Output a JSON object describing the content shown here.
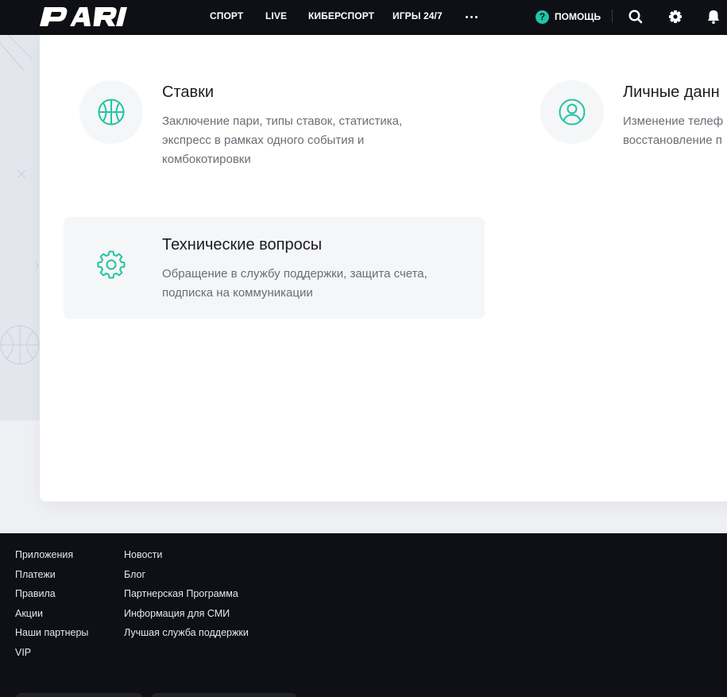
{
  "header": {
    "logo_text": "PARI",
    "nav": [
      {
        "label": "СПОРТ"
      },
      {
        "label": "LIVE"
      },
      {
        "label": "КИБЕРСПОРТ"
      },
      {
        "label": "ИГРЫ 24/7"
      }
    ],
    "help_label": "ПОМОЩЬ",
    "help_badge": "?"
  },
  "topics": {
    "bets": {
      "title": "Ставки",
      "description": "Заключение пари, типы ставок, статистика, экспресс в рамках одного события и комбокотировки",
      "icon": "basketball-icon"
    },
    "personal": {
      "title": "Личные данн",
      "description_line1": "Изменение телеф",
      "description_line2": "восстановление п",
      "icon": "user-icon"
    },
    "technical": {
      "title": "Технические вопросы",
      "description": "Обращение в службу поддержки, защита счета, подписка на коммуникации",
      "icon": "gear-icon"
    }
  },
  "footer": {
    "col1": [
      "Приложения",
      "Платежи",
      "Правила",
      "Акции",
      "Наши партнеры",
      "VIP"
    ],
    "col2": [
      "Новости",
      "Блог",
      "Партнерская Программа",
      "Информация для СМИ",
      "Лучшая служба поддержки"
    ]
  },
  "colors": {
    "accent": "#21c4a5",
    "header_bg": "#0e1015",
    "footer_bg": "#0e1015",
    "page_bg": "#eef0f3"
  }
}
